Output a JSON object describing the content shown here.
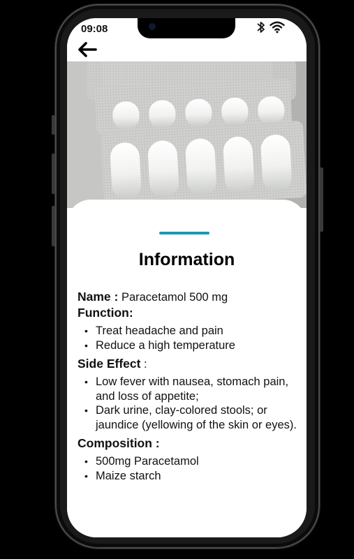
{
  "status_bar": {
    "time": "09:08"
  },
  "header": {
    "back_icon": "arrow-left-icon"
  },
  "photo": {
    "subject": "blister-pack-tablets"
  },
  "info": {
    "title": "Information",
    "name_label": "Name :",
    "name_value": "Paracetamol 500 mg",
    "function_label": "Function:",
    "function_items": [
      "Treat headache and pain",
      "Reduce a high temperature"
    ],
    "side_effect_label": "Side Effect",
    "side_effect_colon": " :",
    "side_effect_items": [
      "Low fever with nausea, stomach pain, and loss of appetite;",
      "Dark urine, clay-colored stools; or jaundice (yellowing of the skin or eyes)."
    ],
    "composition_label": "Composition :",
    "composition_items": [
      "500mg Paracetamol",
      "Maize starch"
    ]
  },
  "colors": {
    "accent": "#1a98b4",
    "background": "#000000",
    "sheet": "#ffffff"
  }
}
